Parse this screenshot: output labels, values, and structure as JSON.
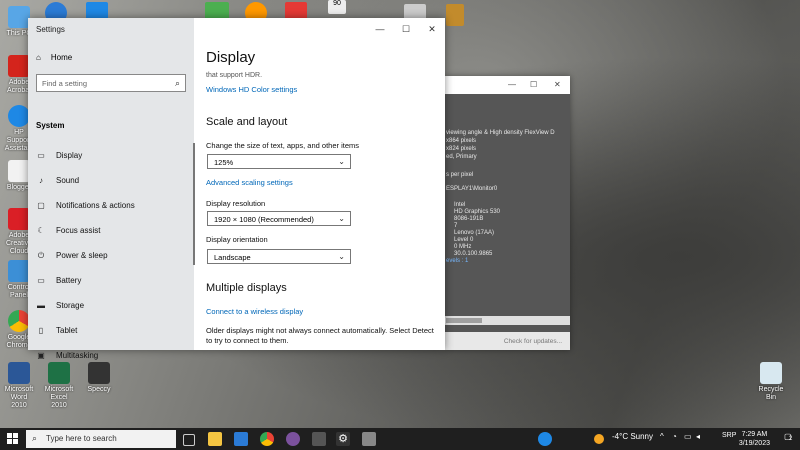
{
  "desktop": {
    "icons": [
      {
        "label": "This PC",
        "color": "#58a6e6"
      },
      {
        "label": "Adobe Acrobat",
        "color": "#d4241c"
      },
      {
        "label": "HP Support Assistant",
        "color": "#1e88e5"
      },
      {
        "label": "Blogger",
        "color": "#f2f2f2"
      },
      {
        "label": "Adobe Creative Cloud",
        "color": "#da1f26"
      },
      {
        "label": "Control Panel",
        "color": "#3c8fd6"
      },
      {
        "label": "Google Chrome",
        "color": "#34a853"
      },
      {
        "label": "Microsoft Word 2010",
        "color": "#2b5797"
      },
      {
        "label": "Microsoft Excel 2010",
        "color": "#1e7145"
      },
      {
        "label": "Speccy",
        "color": "#333333"
      },
      {
        "label": "Recycle Bin",
        "color": "#d8e8f0"
      }
    ],
    "top_badge": "90"
  },
  "settings": {
    "window_title": "Settings",
    "home_label": "Home",
    "search_placeholder": "Find a setting",
    "system_label": "System",
    "nav": [
      {
        "label": "Display",
        "icon": "monitor-icon",
        "glyph": "▭"
      },
      {
        "label": "Sound",
        "icon": "speaker-icon",
        "glyph": "♪"
      },
      {
        "label": "Notifications & actions",
        "icon": "notification-icon",
        "glyph": "▢"
      },
      {
        "label": "Focus assist",
        "icon": "moon-icon",
        "glyph": "☾"
      },
      {
        "label": "Power & sleep",
        "icon": "power-icon",
        "glyph": "⏻"
      },
      {
        "label": "Battery",
        "icon": "battery-icon",
        "glyph": "▭"
      },
      {
        "label": "Storage",
        "icon": "storage-icon",
        "glyph": "▬"
      },
      {
        "label": "Tablet",
        "icon": "tablet-icon",
        "glyph": "▯"
      },
      {
        "label": "Multitasking",
        "icon": "multitasking-icon",
        "glyph": "▣"
      }
    ],
    "content": {
      "page_title": "Display",
      "cut_text": "that support HDR.",
      "hdr_link": "Windows HD Color settings",
      "scale_heading": "Scale and layout",
      "text_size_label": "Change the size of text, apps, and other items",
      "text_size_value": "125%",
      "advanced_scaling_link": "Advanced scaling settings",
      "resolution_label": "Display resolution",
      "resolution_value": "1920 × 1080 (Recommended)",
      "orientation_label": "Display orientation",
      "orientation_value": "Landscape",
      "multiple_heading": "Multiple displays",
      "wireless_link": "Connect to a wireless display",
      "older_displays_text": "Older displays might not always connect automatically. Select Detect to try to connect to them."
    }
  },
  "info_window": {
    "lines": [
      "viewing angle & High density FlexView D",
      "x864 pixels",
      "x824 pixels",
      "ed, Primary",
      "s per pixel",
      "ESPLAY1\\Monitor0"
    ],
    "values": [
      "Intel",
      "HD Graphics 530",
      "8086-191B",
      "7",
      "Lenovo (17AA)",
      "Level 0",
      "0 MHz",
      "30.0.100.9865"
    ],
    "levels_text": "evels : 1",
    "check_updates": "Check for updates..."
  },
  "taskbar": {
    "search_placeholder": "Type here to search",
    "weather": "-4°C  Sunny",
    "lang": "SRP",
    "time": "7:29 AM",
    "date": "3/19/2023",
    "notification_count": "2"
  }
}
